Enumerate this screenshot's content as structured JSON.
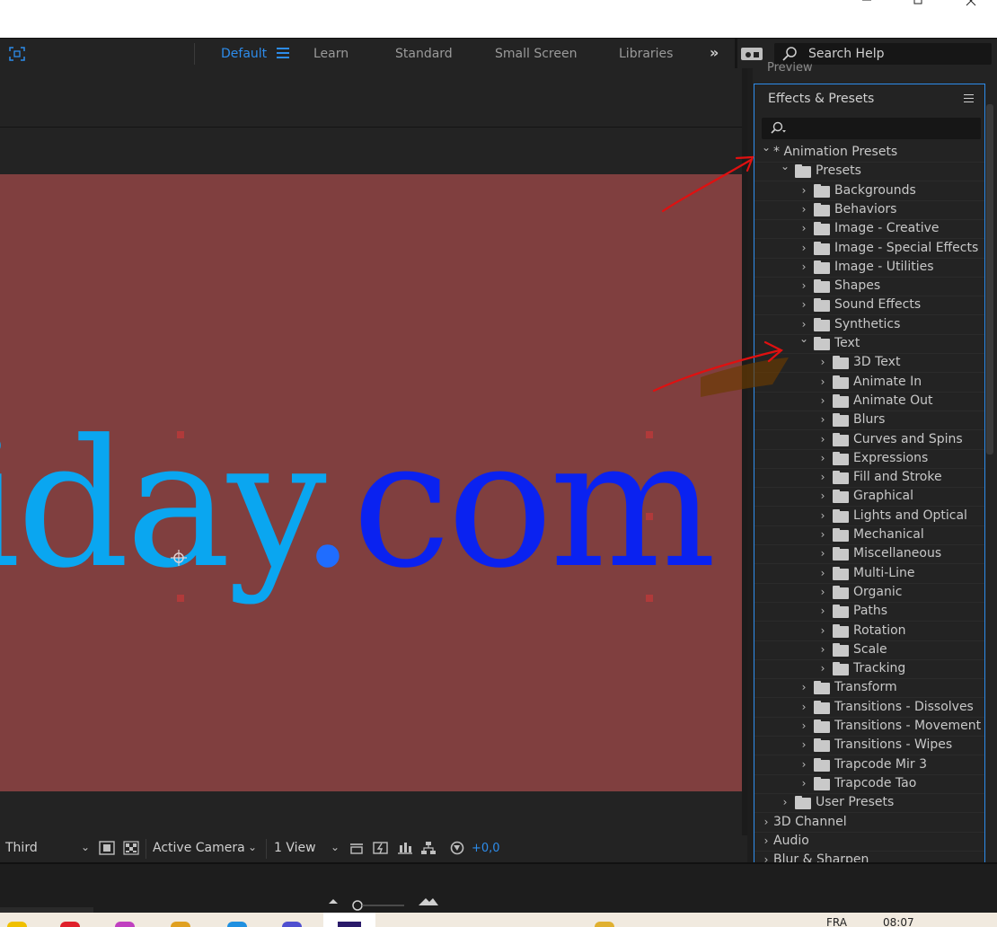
{
  "workspace": {
    "tabs": [
      {
        "label": "Default",
        "active": true
      },
      {
        "label": "Learn"
      },
      {
        "label": "Standard"
      },
      {
        "label": "Small Screen"
      },
      {
        "label": "Libraries"
      }
    ],
    "more_label": "»",
    "search_help_label": "Search Help"
  },
  "composition": {
    "text_segments": [
      "iday",
      ".",
      "com"
    ],
    "text_colors": [
      "#0aa6f0",
      "#1f6dff",
      "#0a22f0"
    ],
    "background_color": "#803f3f"
  },
  "viewer_footer": {
    "view_layout": "Third",
    "camera": "Active Camera",
    "views": "1 View",
    "exposure": "+0,0"
  },
  "effects_panel": {
    "title": "Effects & Presets",
    "top_stub": "Preview",
    "items": [
      {
        "label": "* Animation Presets",
        "level": 0,
        "expanded": true,
        "folder": false
      },
      {
        "label": "Presets",
        "level": 1,
        "expanded": true,
        "folder": true
      },
      {
        "label": "Backgrounds",
        "level": 2,
        "folder": true
      },
      {
        "label": "Behaviors",
        "level": 2,
        "folder": true
      },
      {
        "label": "Image - Creative",
        "level": 2,
        "folder": true
      },
      {
        "label": "Image - Special Effects",
        "level": 2,
        "folder": true
      },
      {
        "label": "Image - Utilities",
        "level": 2,
        "folder": true
      },
      {
        "label": "Shapes",
        "level": 2,
        "folder": true
      },
      {
        "label": "Sound Effects",
        "level": 2,
        "folder": true
      },
      {
        "label": "Synthetics",
        "level": 2,
        "folder": true
      },
      {
        "label": "Text",
        "level": 2,
        "expanded": true,
        "folder": true
      },
      {
        "label": "3D Text",
        "level": 3,
        "folder": true
      },
      {
        "label": "Animate In",
        "level": 3,
        "folder": true
      },
      {
        "label": "Animate Out",
        "level": 3,
        "folder": true
      },
      {
        "label": "Blurs",
        "level": 3,
        "folder": true
      },
      {
        "label": "Curves and Spins",
        "level": 3,
        "folder": true
      },
      {
        "label": "Expressions",
        "level": 3,
        "folder": true
      },
      {
        "label": "Fill and Stroke",
        "level": 3,
        "folder": true
      },
      {
        "label": "Graphical",
        "level": 3,
        "folder": true
      },
      {
        "label": "Lights and Optical",
        "level": 3,
        "folder": true
      },
      {
        "label": "Mechanical",
        "level": 3,
        "folder": true
      },
      {
        "label": "Miscellaneous",
        "level": 3,
        "folder": true
      },
      {
        "label": "Multi-Line",
        "level": 3,
        "folder": true
      },
      {
        "label": "Organic",
        "level": 3,
        "folder": true
      },
      {
        "label": "Paths",
        "level": 3,
        "folder": true
      },
      {
        "label": "Rotation",
        "level": 3,
        "folder": true
      },
      {
        "label": "Scale",
        "level": 3,
        "folder": true
      },
      {
        "label": "Tracking",
        "level": 3,
        "folder": true
      },
      {
        "label": "Transform",
        "level": 2,
        "folder": true
      },
      {
        "label": "Transitions - Dissolves",
        "level": 2,
        "folder": true
      },
      {
        "label": "Transitions - Movement",
        "level": 2,
        "folder": true
      },
      {
        "label": "Transitions - Wipes",
        "level": 2,
        "folder": true
      },
      {
        "label": "Trapcode Mir 3",
        "level": 2,
        "folder": true
      },
      {
        "label": "Trapcode Tao",
        "level": 2,
        "folder": true
      },
      {
        "label": "User Presets",
        "level": 1,
        "folder": true
      },
      {
        "label": "3D Channel",
        "level": 0,
        "folder": false
      },
      {
        "label": "Audio",
        "level": 0,
        "folder": false
      },
      {
        "label": "Blur & Sharpen",
        "level": 0,
        "folder": false
      }
    ]
  },
  "taskbar": {
    "lang": "FRA",
    "time": "08:07"
  },
  "colors": {
    "accent": "#2d8ceb",
    "annotation": "#e01010"
  }
}
